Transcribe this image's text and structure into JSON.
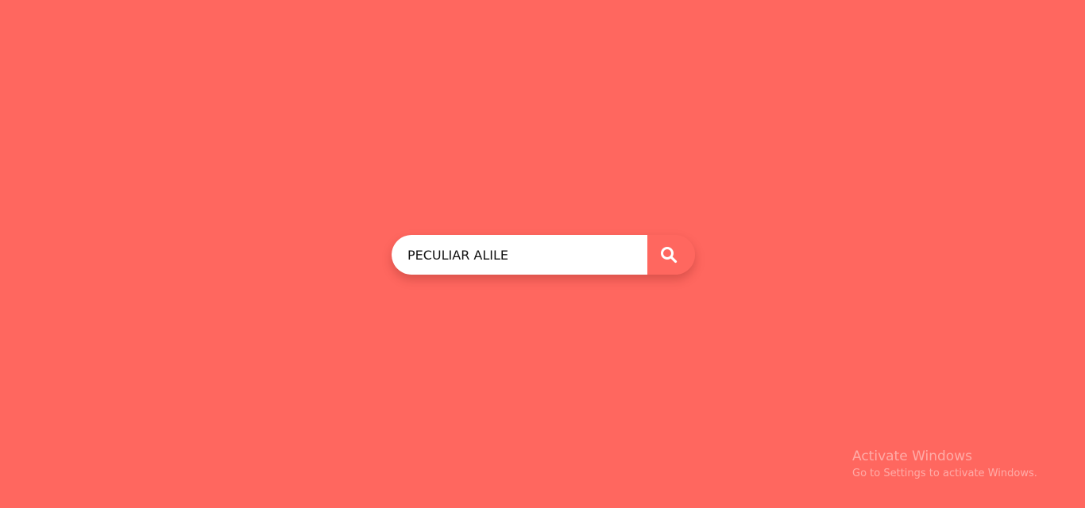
{
  "search": {
    "value": "PECULIAR ALILE",
    "placeholder": "",
    "button_icon": "search-icon"
  },
  "watermark": {
    "title": "Activate Windows",
    "subtitle": "Go to Settings to activate Windows."
  },
  "colors": {
    "background": "#ff675f",
    "input_background": "#ffffff",
    "button_background": "#ff675f",
    "icon": "#ffffff"
  }
}
